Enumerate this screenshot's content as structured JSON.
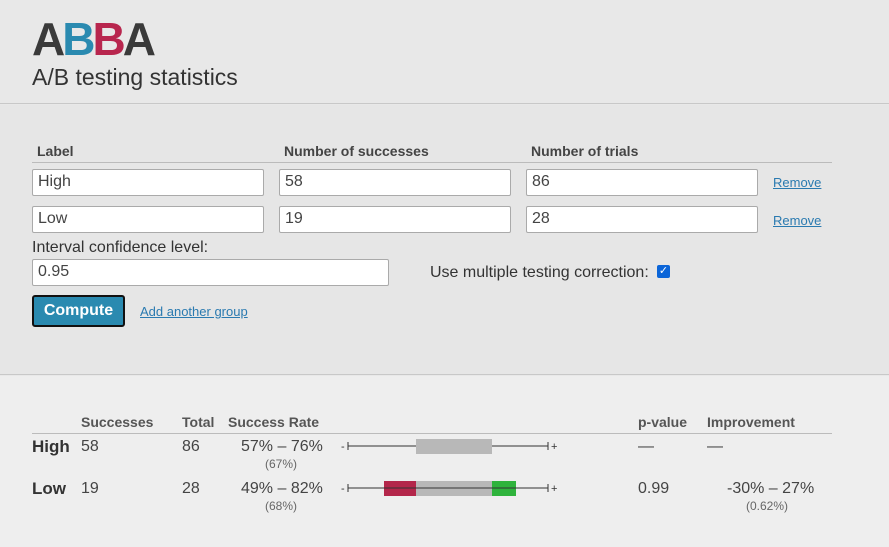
{
  "logo": {
    "l1": "A",
    "l2": "B",
    "l3": "B",
    "l4": "A"
  },
  "subtitle": "A/B testing statistics",
  "form": {
    "headers": {
      "label": "Label",
      "successes": "Number of successes",
      "trials": "Number of trials"
    },
    "groups": [
      {
        "label": "High",
        "successes": "58",
        "trials": "86",
        "remove": "Remove"
      },
      {
        "label": "Low",
        "successes": "19",
        "trials": "28",
        "remove": "Remove"
      }
    ],
    "confidence_label": "Interval confidence level:",
    "confidence_value": "0.95",
    "mtc_label": "Use multiple testing correction:",
    "mtc_checked": true,
    "compute_label": "Compute",
    "add_group_label": "Add another group"
  },
  "results": {
    "headers": {
      "successes": "Successes",
      "total": "Total",
      "rate": "Success Rate",
      "pvalue": "p-value",
      "improvement": "Improvement"
    },
    "rows": [
      {
        "label": "High",
        "successes": "58",
        "total": "86",
        "rate": "57% – 76%",
        "rate_point": "(67%)",
        "pvalue": "—",
        "improvement": "—",
        "improvement_point": ""
      },
      {
        "label": "Low",
        "successes": "19",
        "total": "28",
        "rate": "49% – 82%",
        "rate_point": "(68%)",
        "pvalue": "0.99",
        "improvement": "-30% – 27%",
        "improvement_point": "(0.62%)"
      }
    ],
    "minus_sign": "-",
    "plus_sign": "+",
    "colors": {
      "grey": "#b8b8b8",
      "red": "#b3264a",
      "green": "#2fb33c"
    },
    "bar_scale": {
      "min_pct": 40,
      "max_pct": 90
    },
    "bars": [
      {
        "lower_pct": 57,
        "upper_pct": 76,
        "red_pct": null,
        "green_pct": null
      },
      {
        "lower_pct": 49,
        "upper_pct": 82,
        "red_pct": 57,
        "green_pct": 76
      }
    ]
  }
}
